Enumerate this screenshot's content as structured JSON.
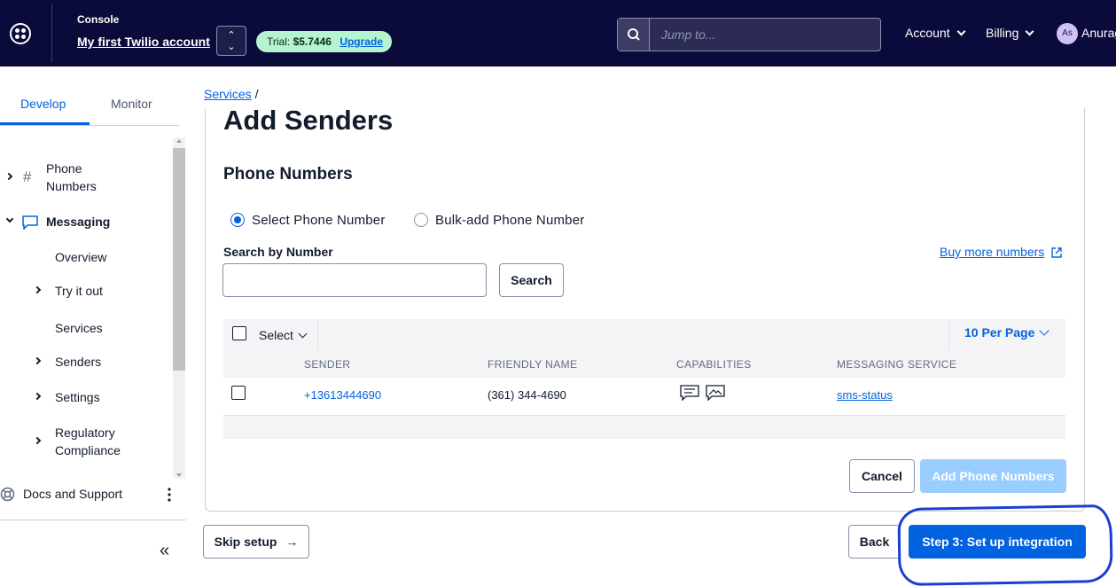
{
  "topbar": {
    "console_label": "Console",
    "account_name": "My first Twilio account",
    "trial_label": "Trial:",
    "trial_amount": "$5.7446",
    "upgrade_label": "Upgrade",
    "search_placeholder": "Jump to...",
    "account_menu": "Account",
    "billing_menu": "Billing",
    "avatar_initials": "As",
    "user_name": "Anurag"
  },
  "sidebar": {
    "tabs": [
      {
        "label": "Develop"
      },
      {
        "label": "Monitor"
      }
    ],
    "items": [
      {
        "label": "Phone"
      },
      {
        "label": "Numbers"
      },
      {
        "label": "Messaging"
      },
      {
        "label": "Overview"
      },
      {
        "label": "Try it out"
      },
      {
        "label": "Services"
      },
      {
        "label": "Senders"
      },
      {
        "label": "Settings"
      },
      {
        "label": "Regulatory"
      },
      {
        "label": "Compliance"
      }
    ],
    "docs_label": "Docs and Support",
    "collapse_glyph": "«"
  },
  "breadcrumb": {
    "link": "Services",
    "sep": "/"
  },
  "main": {
    "title": "Add Senders",
    "section_title": "Phone Numbers",
    "radio_options": [
      {
        "label": "Select Phone Number",
        "selected": true
      },
      {
        "label": "Bulk-add Phone Number",
        "selected": false
      }
    ],
    "search_label": "Search by Number",
    "search_value": "",
    "search_button": "Search",
    "buy_link": "Buy more numbers",
    "table": {
      "select_label": "Select",
      "per_page": "10 Per Page",
      "columns": [
        "SENDER",
        "FRIENDLY NAME",
        "CAPABILITIES",
        "MESSAGING SERVICE"
      ],
      "rows": [
        {
          "sender": "+13613444690",
          "friendly_name": "(361) 344-4690",
          "capabilities": [
            "sms-icon",
            "mms-icon"
          ],
          "messaging_service": "sms-status"
        }
      ]
    },
    "cancel_button": "Cancel",
    "add_button": "Add Phone Numbers"
  },
  "footer": {
    "skip_button": "Skip setup",
    "skip_arrow": "→",
    "back_button": "Back",
    "next_button": "Step 3: Set up integration"
  },
  "colors": {
    "topbar": "#0b0b3b",
    "primary": "#0263e0",
    "trial_pill": "#b6f4d0",
    "disabled_button": "#99cdff",
    "annotation": "#1a3fd1"
  }
}
